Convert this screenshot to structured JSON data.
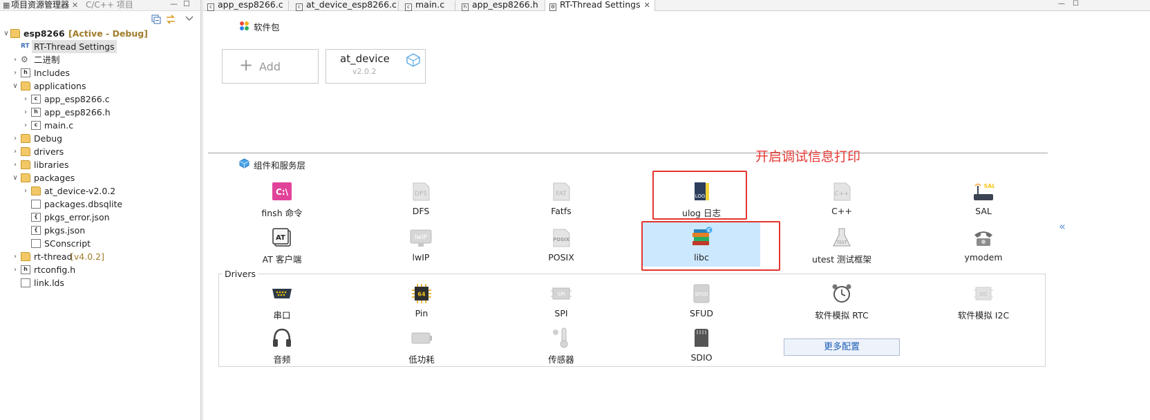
{
  "explorer": {
    "tabs": [
      {
        "label": "项目资源管理器",
        "close": "✕"
      },
      {
        "label": "C/C++ 项目"
      }
    ],
    "minimize": "—",
    "maximize": "☐",
    "tree": [
      {
        "label": "esp8266",
        "extra": "[Active - Debug]",
        "bold": true
      },
      {
        "label": "RT-Thread Settings"
      },
      {
        "label": "二进制"
      },
      {
        "label": "Includes"
      },
      {
        "label": "applications"
      },
      {
        "label": "app_esp8266.c"
      },
      {
        "label": "app_esp8266.h"
      },
      {
        "label": "main.c"
      },
      {
        "label": "Debug"
      },
      {
        "label": "drivers"
      },
      {
        "label": "libraries"
      },
      {
        "label": "packages"
      },
      {
        "label": "at_device-v2.0.2"
      },
      {
        "label": "packages.dbsqlite"
      },
      {
        "label": "pkgs_error.json"
      },
      {
        "label": "pkgs.json"
      },
      {
        "label": "SConscript"
      },
      {
        "label": "rt-thread",
        "extra": "[v4.0.2]"
      },
      {
        "label": "rtconfig.h"
      },
      {
        "label": "link.lds"
      }
    ]
  },
  "editor": {
    "tabs": [
      {
        "label": "app_esp8266.c",
        "icon": "c-file-icon"
      },
      {
        "label": "at_device_esp8266.c",
        "icon": "c-file-icon"
      },
      {
        "label": "main.c",
        "icon": "c-file-icon"
      },
      {
        "label": "app_esp8266.h",
        "icon": "h-file-icon"
      },
      {
        "label": "RT-Thread Settings",
        "icon": "settings-icon",
        "close": "✕"
      }
    ]
  },
  "packages": {
    "title": "软件包",
    "add_label": "Add",
    "card": {
      "name": "at_device",
      "version": "v2.0.2"
    }
  },
  "components": {
    "title": "组件和服务层",
    "annotation": "开启调试信息打印",
    "items": [
      {
        "label": "finsh 命令"
      },
      {
        "label": "DFS"
      },
      {
        "label": "Fatfs"
      },
      {
        "label": "ulog 日志"
      },
      {
        "label": "C++"
      },
      {
        "label": "SAL"
      },
      {
        "label": "AT 客户端"
      },
      {
        "label": "lwIP"
      },
      {
        "label": "POSIX"
      },
      {
        "label": "libc"
      },
      {
        "label": "utest 测试框架"
      },
      {
        "label": "ymodem"
      }
    ]
  },
  "drivers": {
    "title": "Drivers",
    "items": [
      {
        "label": "串口"
      },
      {
        "label": "Pin"
      },
      {
        "label": "SPI"
      },
      {
        "label": "SFUD"
      },
      {
        "label": "软件模拟 RTC"
      },
      {
        "label": "软件模拟 I2C"
      },
      {
        "label": "音频"
      },
      {
        "label": "低功耗"
      },
      {
        "label": "传感器"
      },
      {
        "label": "SDIO"
      }
    ],
    "more_button": "更多配置"
  },
  "colors": {
    "accent": "#1a5eb5",
    "highlight": "#cce8ff",
    "annotation": "#e53935"
  }
}
